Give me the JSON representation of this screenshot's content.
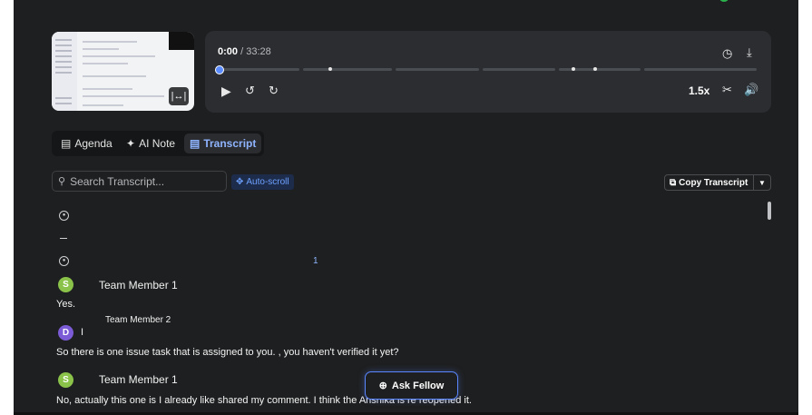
{
  "player": {
    "current_time": "0:00",
    "separator": " / ",
    "duration": "33:28",
    "progress": 0,
    "speed": "1.5x",
    "icons": [
      "clock-icon",
      "download-icon",
      "play-icon",
      "rewind-10-icon",
      "forward-10-icon",
      "scissors-icon",
      "volume-icon",
      "expand-icon"
    ]
  },
  "tabs": [
    {
      "label": "Agenda",
      "icon": "agenda-icon",
      "active": false
    },
    {
      "label": "AI Note",
      "icon": "sparkle-icon",
      "active": false
    },
    {
      "label": "Transcript",
      "icon": "transcript-icon",
      "active": true
    }
  ],
  "search": {
    "placeholder": "Search Transcript..."
  },
  "toolbar": {
    "auto_scroll": "Auto-scroll",
    "copy_transcript": "Copy Transcript"
  },
  "transcript": {
    "count": "1",
    "entries": [
      {
        "initial": "S",
        "speaker": "Team Member 1",
        "text": "Yes.",
        "color": "#8bc34a"
      },
      {
        "initial": "D",
        "speaker": "Team Member 2",
        "suffix": "I",
        "text": "So there is one issue task that is assigned to you.          , you haven't verified it yet?",
        "color": "#7c5cd6"
      },
      {
        "initial": "S",
        "speaker": "Team Member 1",
        "text": "No, actually this one is I already like shared my comment. I think the Anshika is re reopened it.",
        "color": "#8bc34a"
      }
    ]
  },
  "ask_fellow": {
    "label": "Ask Fellow"
  },
  "colors": {
    "background": "#1e1f20",
    "accent": "#5a86ff",
    "panel": "#2b2d30"
  }
}
